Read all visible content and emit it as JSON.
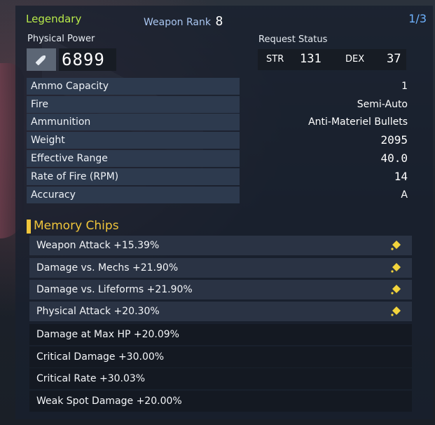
{
  "header": {
    "rarity": "Legendary",
    "rank_label": "Weapon Rank",
    "rank_value": "8",
    "page": "1/3"
  },
  "power": {
    "label": "Physical Power",
    "icon": "bullet-icon",
    "value": "6899"
  },
  "request": {
    "label": "Request Status",
    "str_label": "STR",
    "str_value": "131",
    "dex_label": "DEX",
    "dex_value": "37"
  },
  "stats": [
    {
      "name": "Ammo Capacity",
      "value": "1"
    },
    {
      "name": "Fire",
      "value": "Semi-Auto"
    },
    {
      "name": "Ammunition",
      "value": "Anti-Materiel Bullets"
    },
    {
      "name": "Weight",
      "value": "2095"
    },
    {
      "name": "Effective Range",
      "value": "40.0"
    },
    {
      "name": "Rate of Fire (RPM)",
      "value": "14"
    },
    {
      "name": "Accuracy",
      "value": "A"
    }
  ],
  "chips_title": "Memory Chips",
  "chips": [
    {
      "label": "Weapon Attack +15.39%",
      "icon": "diamond-icon"
    },
    {
      "label": "Damage vs. Mechs +21.90%",
      "icon": "diamond-icon"
    },
    {
      "label": "Damage vs. Lifeforms +21.90%",
      "icon": "diamond-icon"
    },
    {
      "label": "Physical Attack +20.30%",
      "icon": "diamond-icon"
    },
    {
      "label": "Damage at Max HP +20.09%"
    },
    {
      "label": "Critical Damage +30.00%"
    },
    {
      "label": "Critical Rate +30.03%"
    },
    {
      "label": "Weak Spot Damage +20.00%"
    }
  ],
  "colors": {
    "legendary": "#b8ea4a",
    "chip_title": "#f0c53b",
    "chip_icon": "#f2d43c",
    "page": "#6fb3ff"
  }
}
